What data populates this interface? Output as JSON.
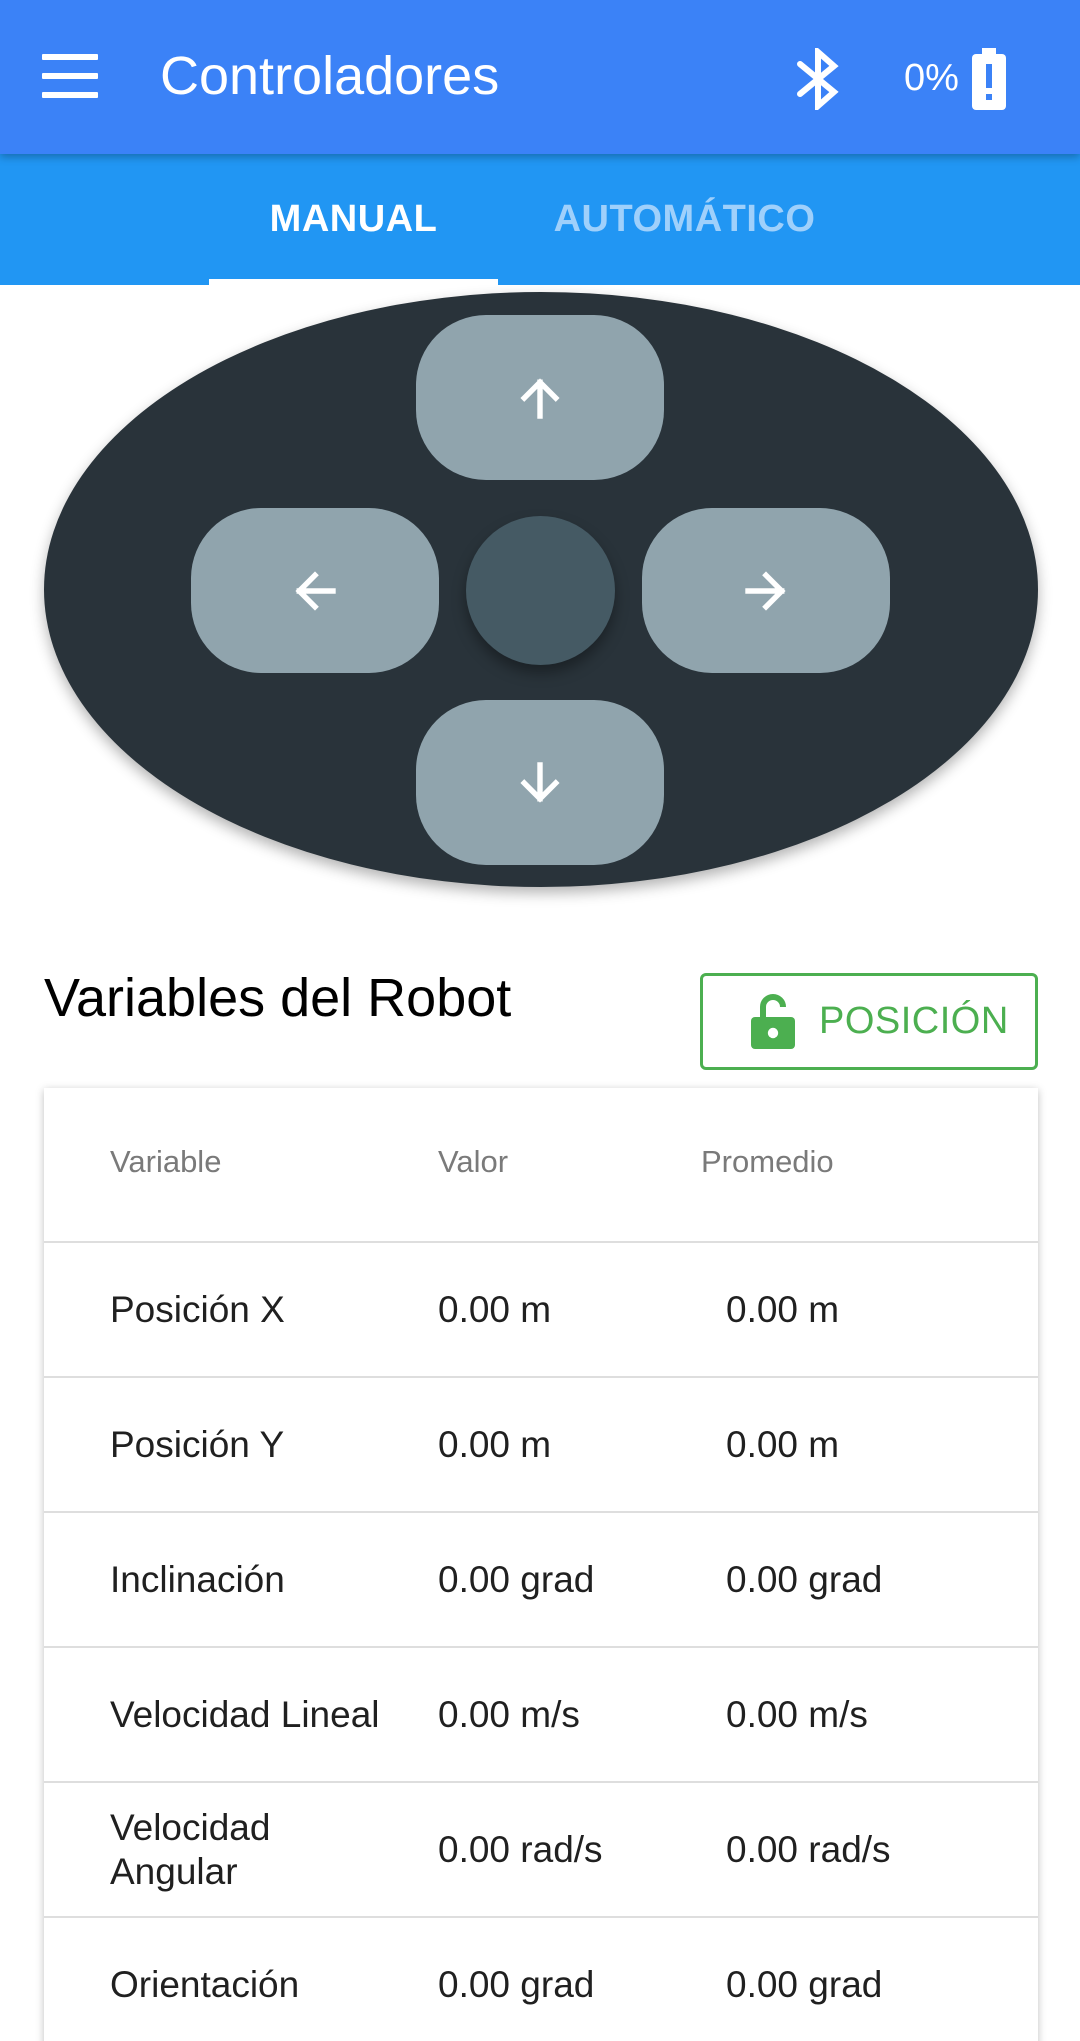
{
  "appbar": {
    "title": "Controladores",
    "battery_text": "0%"
  },
  "tabs": [
    {
      "label": "MANUAL",
      "active": true
    },
    {
      "label": "AUTOMÁTICO",
      "active": false
    }
  ],
  "controller": {
    "buttons": [
      "arrow-up-icon",
      "arrow-left-icon",
      "arrow-right-icon",
      "arrow-down-icon"
    ]
  },
  "section": {
    "title": "Variables del Robot",
    "position_button": "POSICIÓN"
  },
  "table": {
    "headers": [
      "Variable",
      "Valor",
      "Promedio"
    ],
    "rows": [
      {
        "variable": "Posición X",
        "valor": "0.00 m",
        "promedio": "0.00 m"
      },
      {
        "variable": "Posición Y",
        "valor": "0.00 m",
        "promedio": "0.00 m"
      },
      {
        "variable": "Inclinación",
        "valor": "0.00 grad",
        "promedio": "0.00 grad"
      },
      {
        "variable": "Velocidad Lineal",
        "valor": "0.00 m/s",
        "promedio": "0.00 m/s"
      },
      {
        "variable": "Velocidad Angular",
        "valor": "0.00 rad/s",
        "promedio": "0.00 rad/s"
      },
      {
        "variable": "Orientación",
        "valor": "0.00 grad",
        "promedio": "0.00 grad"
      }
    ]
  },
  "colors": {
    "appbar": "#3b82f7",
    "tabs": "#2196f3",
    "pad": "#29333a",
    "pad_button": "#90a4ad",
    "accent_green": "#4caf50"
  }
}
